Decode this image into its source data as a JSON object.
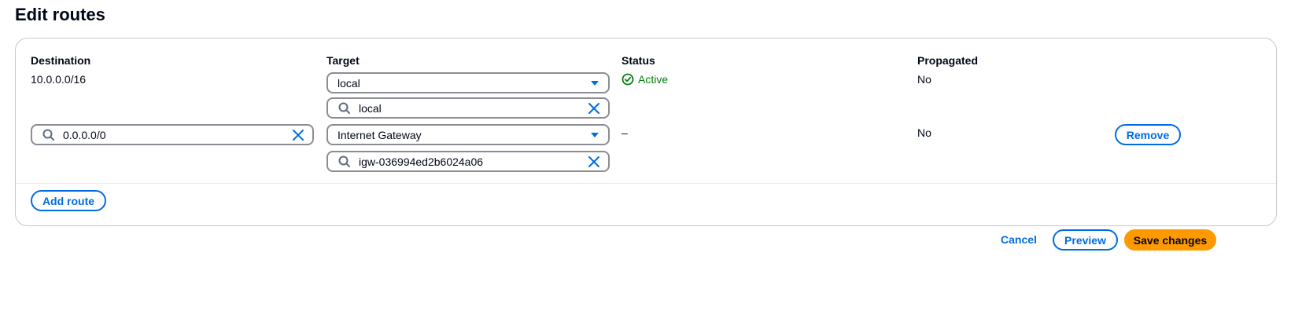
{
  "page": {
    "title": "Edit routes"
  },
  "columns": {
    "destination": "Destination",
    "target": "Target",
    "status": "Status",
    "propagated": "Propagated"
  },
  "routes": [
    {
      "destination": "10.0.0.0/16",
      "target_type": "local",
      "target_value": "local",
      "status": "Active",
      "propagated": "No"
    },
    {
      "destination": "0.0.0.0/0",
      "target_type": "Internet Gateway",
      "target_value": "igw-036994ed2b6024a06",
      "status": "–",
      "propagated": "No",
      "remove_label": "Remove"
    }
  ],
  "actions": {
    "add_route": "Add route",
    "cancel": "Cancel",
    "preview": "Preview",
    "save": "Save changes"
  },
  "colors": {
    "accent": "#006ce0",
    "success": "#037f0c",
    "primary_button": "#ff9900"
  },
  "icons": [
    "search-icon",
    "clear-icon",
    "caret-down-icon",
    "check-circle-icon"
  ]
}
